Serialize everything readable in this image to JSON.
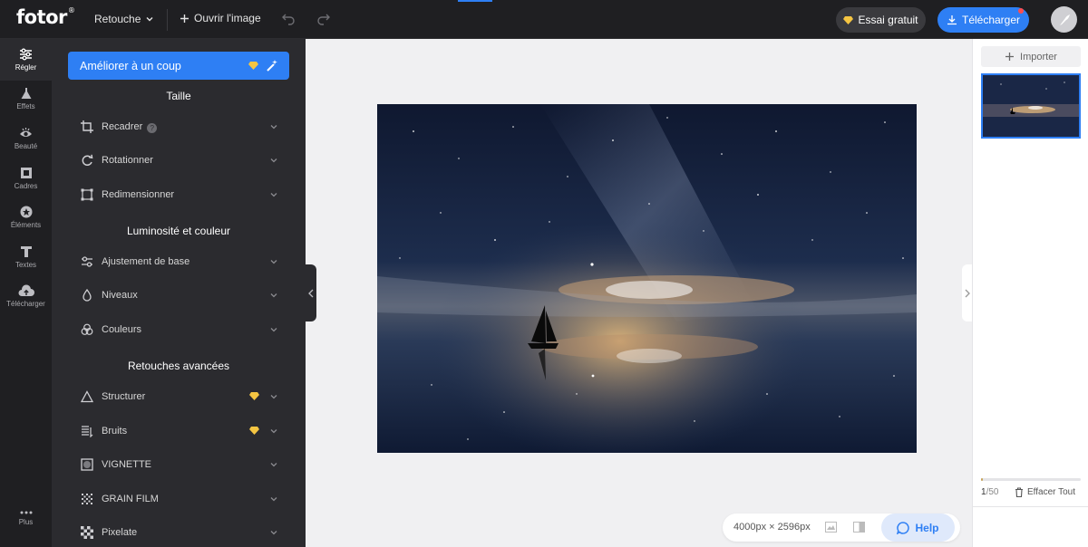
{
  "app": {
    "logo": "fotor",
    "logo_mark": "®",
    "mode_label": "Retouche",
    "open_image_label": "Ouvrir l'image",
    "trial_label": "Essai gratuit",
    "download_label": "Télécharger"
  },
  "rail": {
    "items": [
      {
        "label": "Régler",
        "icon": "sliders-icon"
      },
      {
        "label": "Effets",
        "icon": "flask-icon"
      },
      {
        "label": "Beauté",
        "icon": "eye-icon"
      },
      {
        "label": "Cadres",
        "icon": "frame-icon"
      },
      {
        "label": "Éléments",
        "icon": "star-icon"
      },
      {
        "label": "Textes",
        "icon": "text-icon"
      },
      {
        "label": "Télécharger",
        "icon": "cloud-upload-icon"
      }
    ],
    "more_label": "Plus"
  },
  "panel": {
    "enhance_label": "Améliorer à un coup",
    "sections": {
      "size": "Taille",
      "light_color": "Luminosité et couleur",
      "advanced": "Retouches avancées"
    },
    "rows": [
      {
        "label": "Recadrer",
        "icon": "crop-icon",
        "premium": false
      },
      {
        "label": "Rotationner",
        "icon": "rotate-icon",
        "premium": false
      },
      {
        "label": "Redimensionner",
        "icon": "resize-icon",
        "premium": false
      },
      {
        "label": "Ajustement de base",
        "icon": "adjust-icon",
        "premium": false
      },
      {
        "label": "Niveaux",
        "icon": "drop-icon",
        "premium": false
      },
      {
        "label": "Couleurs",
        "icon": "color-circles-icon",
        "premium": false
      },
      {
        "label": "Structurer",
        "icon": "triangle-icon",
        "premium": true
      },
      {
        "label": "Bruits",
        "icon": "noise-icon",
        "premium": true
      },
      {
        "label": "VIGNETTE",
        "icon": "vignette-icon",
        "premium": false
      },
      {
        "label": "GRAIN FILM",
        "icon": "grain-icon",
        "premium": false
      },
      {
        "label": "Pixelate",
        "icon": "pixelate-icon",
        "premium": false
      }
    ]
  },
  "canvas": {
    "dimensions": "4000px × 2596px",
    "help_label": "Help"
  },
  "right_panel": {
    "import_label": "Importer",
    "count_current": "1",
    "count_total": "/50",
    "clear_label": "Effacer Tout",
    "usage_fraction": 0.02
  },
  "colors": {
    "accent": "#2e7ff4",
    "dark_bg": "#1f1f22",
    "panel_bg": "#2b2b2f",
    "premium_gem": "#f5c542"
  }
}
